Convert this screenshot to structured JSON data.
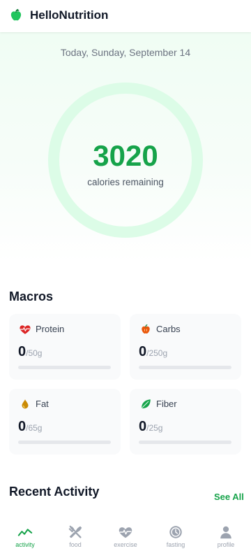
{
  "app": {
    "title": "HelloNutrition"
  },
  "summary": {
    "date": "Today, Sunday, September 14",
    "calories_remaining": "3020",
    "calories_label": "calories remaining"
  },
  "macros": {
    "title": "Macros",
    "items": [
      {
        "name": "Protein",
        "amount": "0",
        "goal": "/50g",
        "icon": "heart-pulse-icon",
        "color": "#dc2626",
        "progress": 0
      },
      {
        "name": "Carbs",
        "amount": "0",
        "goal": "/250g",
        "icon": "apple-icon",
        "color": "#ea580c",
        "progress": 0
      },
      {
        "name": "Fat",
        "amount": "0",
        "goal": "/65g",
        "icon": "droplet-icon",
        "color": "#ca8a04",
        "progress": 0
      },
      {
        "name": "Fiber",
        "amount": "0",
        "goal": "/25g",
        "icon": "leaf-icon",
        "color": "#16a34a",
        "progress": 0
      }
    ]
  },
  "activity": {
    "title": "Recent Activity",
    "see_all": "See All"
  },
  "nav": {
    "items": [
      {
        "label": "activity",
        "icon": "activity-chart-icon",
        "active": true
      },
      {
        "label": "food",
        "icon": "fork-knife-icon",
        "active": false
      },
      {
        "label": "exercise",
        "icon": "heart-pulse-icon",
        "active": false
      },
      {
        "label": "fasting",
        "icon": "timer-icon",
        "active": false
      },
      {
        "label": "profile",
        "icon": "person-icon",
        "active": false
      }
    ]
  },
  "colors": {
    "accent": "#16a34a",
    "ring": "#dcfce7",
    "inactive": "#9ca3af"
  }
}
